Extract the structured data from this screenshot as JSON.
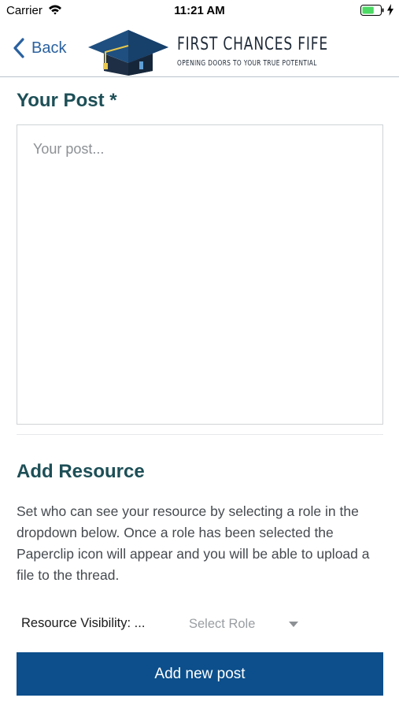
{
  "status_bar": {
    "carrier": "Carrier",
    "time": "11:21 AM",
    "battery_level": 0.65
  },
  "nav": {
    "back_label": "Back",
    "logo": {
      "title": "FIRST CHANCES FIFE",
      "tagline": "OPENING DOORS TO YOUR TRUE POTENTIAL"
    }
  },
  "post": {
    "heading": "Your Post *",
    "value": "",
    "placeholder": "Your post..."
  },
  "resource": {
    "heading": "Add Resource",
    "description": "Set who can see your resource by selecting a role in the dropdown below. Once a role has been selected the Paperclip icon will appear and you will be able to upload a file to the thread.",
    "visibility_label": "Resource Visibility: ...",
    "role_select": {
      "selected": "Select Role"
    }
  },
  "actions": {
    "add_post_label": "Add new post"
  },
  "colors": {
    "accent_blue": "#0c4f8c",
    "back_link": "#2a61a0",
    "heading_teal": "#1d4f57",
    "battery_green": "#4cd964"
  }
}
